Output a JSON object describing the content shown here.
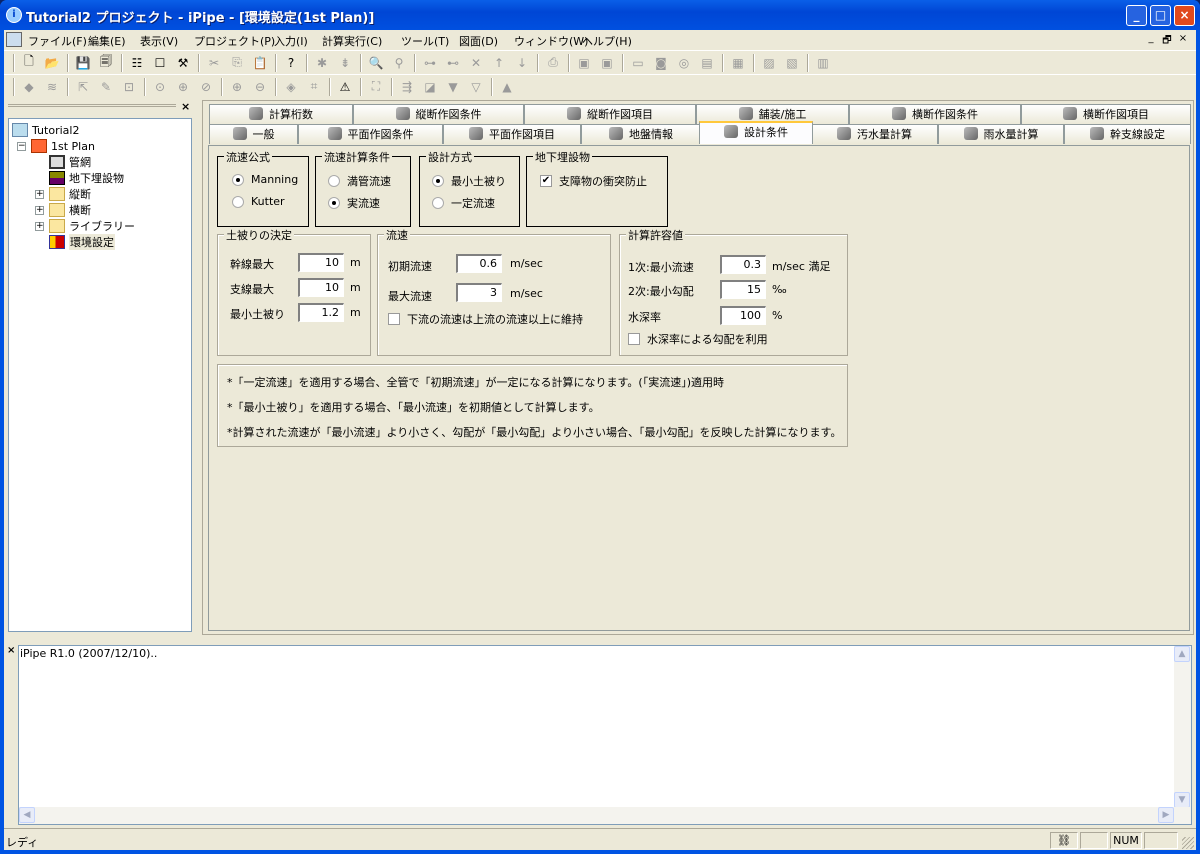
{
  "window": {
    "title": "Tutorial2 プロジェクト - iPipe - [環境設定(1st Plan)]",
    "minimize": "_",
    "maximize": "□",
    "close": "×"
  },
  "menu": [
    "ファイル(F)",
    "編集(E)",
    "表示(V)",
    "プロジェクト(P)",
    "入力(I)",
    "計算実行(C)",
    "ツール(T)",
    "図面(D)",
    "ウィンドウ(W)",
    "ヘルプ(H)"
  ],
  "mdi_controls": [
    "_",
    "🗗",
    "×"
  ],
  "toolbar1": [
    {
      "icon": "new-file-icon",
      "g": "🗋",
      "on": true
    },
    {
      "icon": "open-folder-icon",
      "g": "📂",
      "on": true
    },
    {
      "sep": true
    },
    {
      "icon": "save-icon",
      "g": "💾",
      "on": true
    },
    {
      "icon": "save-all-icon",
      "g": "🗐",
      "on": true
    },
    {
      "sep": true
    },
    {
      "icon": "tree-view-icon",
      "g": "☷",
      "on": true
    },
    {
      "icon": "window-icon",
      "g": "☐",
      "on": true
    },
    {
      "icon": "hammer-icon",
      "g": "⚒",
      "on": true
    },
    {
      "sep": true
    },
    {
      "icon": "cut-icon",
      "g": "✂"
    },
    {
      "icon": "copy-icon",
      "g": "⎘"
    },
    {
      "icon": "paste-icon",
      "g": "📋"
    },
    {
      "sep": true
    },
    {
      "icon": "help-icon",
      "g": "?",
      "on": true
    },
    {
      "sep": true
    },
    {
      "icon": "bug-icon",
      "g": "✱"
    },
    {
      "icon": "sort-icon",
      "g": "⇟"
    },
    {
      "sep": true
    },
    {
      "icon": "find-icon",
      "g": "🔍"
    },
    {
      "icon": "find-replace-icon",
      "g": "⚲"
    },
    {
      "sep": true
    },
    {
      "icon": "insert-node-icon",
      "g": "⊶"
    },
    {
      "icon": "insert-node2-icon",
      "g": "⊷"
    },
    {
      "icon": "delete-icon",
      "g": "✕"
    },
    {
      "icon": "arrow-up-icon",
      "g": "↑"
    },
    {
      "icon": "arrow-down-icon",
      "g": "↓"
    },
    {
      "sep": true
    },
    {
      "icon": "print-icon",
      "g": "⎙"
    },
    {
      "sep": true
    },
    {
      "icon": "drawing1-icon",
      "g": "▣"
    },
    {
      "icon": "drawing2-icon",
      "g": "▣"
    },
    {
      "sep": true
    },
    {
      "icon": "drawing3-icon",
      "g": "▭"
    },
    {
      "icon": "drawing4-icon",
      "g": "◙"
    },
    {
      "icon": "drawing5-icon",
      "g": "◎"
    },
    {
      "icon": "drawing6-icon",
      "g": "▤"
    },
    {
      "sep": true
    },
    {
      "icon": "drawing7-icon",
      "g": "▦"
    },
    {
      "sep": true
    },
    {
      "icon": "chart1-icon",
      "g": "▨"
    },
    {
      "icon": "chart2-icon",
      "g": "▧"
    },
    {
      "sep": true
    },
    {
      "icon": "table-icon",
      "g": "▥"
    }
  ],
  "toolbar2": [
    {
      "icon": "select-icon",
      "g": "◆"
    },
    {
      "icon": "layers-icon",
      "g": "≋"
    },
    {
      "sep": true
    },
    {
      "icon": "pointer-icon",
      "g": "⇱"
    },
    {
      "icon": "edit-point-icon",
      "g": "✎"
    },
    {
      "icon": "zoom-window-icon",
      "g": "⊡"
    },
    {
      "sep": true
    },
    {
      "icon": "zoom-all-icon",
      "g": "⊙"
    },
    {
      "icon": "zoom-pan-icon",
      "g": "⊕"
    },
    {
      "icon": "zoom-previous-icon",
      "g": "⊘"
    },
    {
      "sep": true
    },
    {
      "icon": "zoom-in-icon",
      "g": "⊕"
    },
    {
      "icon": "zoom-out-icon",
      "g": "⊖"
    },
    {
      "sep": true
    },
    {
      "icon": "fill-icon",
      "g": "◈"
    },
    {
      "icon": "dimension-icon",
      "g": "⌗"
    },
    {
      "sep": true
    },
    {
      "icon": "warning-icon",
      "g": "⚠",
      "on": true
    },
    {
      "sep": true
    },
    {
      "icon": "manhole-icon",
      "g": "⛶"
    },
    {
      "sep": true
    },
    {
      "icon": "pipe-icon",
      "g": "⇶"
    },
    {
      "icon": "profile-icon",
      "g": "◪"
    },
    {
      "icon": "cup-icon",
      "g": "▼"
    },
    {
      "icon": "box-icon",
      "g": "▽"
    },
    {
      "sep": true
    },
    {
      "icon": "triangle-icon",
      "g": "▲"
    }
  ],
  "tree": {
    "root": "Tutorial2",
    "plan": "1st Plan",
    "items": [
      "管網",
      "地下埋設物",
      "縦断",
      "横断",
      "ライブラリー",
      "環境設定"
    ]
  },
  "tabs_row1": [
    "計算桁数",
    "縦断作図条件",
    "縦断作図項目",
    "舗装/施工",
    "横断作図条件",
    "横断作図項目"
  ],
  "tabs_row2": [
    "一般",
    "平面作図条件",
    "平面作図項目",
    "地盤情報",
    "設計条件",
    "汚水量計算",
    "雨水量計算",
    "幹支線設定"
  ],
  "form": {
    "velocity_formula": {
      "label": "流速公式",
      "options": [
        "Manning",
        "Kutter"
      ],
      "selected": 0
    },
    "velocity_condition": {
      "label": "流速計算条件",
      "options": [
        "満管流速",
        "実流速"
      ],
      "selected": 1
    },
    "design_method": {
      "label": "設計方式",
      "options": [
        "最小土被り",
        "一定流速"
      ],
      "selected": 0
    },
    "underground": {
      "label": "地下埋設物",
      "checkbox": "支障物の衝突防止",
      "checked": true
    },
    "cover": {
      "label": "土被りの決定",
      "rows": [
        {
          "label": "幹線最大",
          "value": "10",
          "unit": "m"
        },
        {
          "label": "支線最大",
          "value": "10",
          "unit": "m"
        },
        {
          "label": "最小土被り",
          "value": "1.2",
          "unit": "m"
        }
      ]
    },
    "velocity": {
      "label": "流速",
      "rows": [
        {
          "label": "初期流速",
          "value": "0.6",
          "unit": "m/sec"
        },
        {
          "label": "最大流速",
          "value": "3",
          "unit": "m/sec"
        }
      ],
      "checkbox": "下流の流速は上流の流速以上に維持",
      "checked": false
    },
    "tolerance": {
      "label": "計算許容値",
      "rows": [
        {
          "label": "1次:最小流速",
          "value": "0.3",
          "unit": "m/sec 満足"
        },
        {
          "label": "2次:最小勾配",
          "value": "15",
          "unit": "‰"
        },
        {
          "label": "水深率",
          "value": "100",
          "unit": "%"
        }
      ],
      "checkbox": "水深率による勾配を利用",
      "checked": false
    },
    "notes": [
      "*「一定流速」を適用する場合、全管で「初期流速」が一定になる計算になります。(「実流速」)適用時",
      "*「最小土被り」を適用する場合、「最小流速」を初期値として計算します。",
      "*計算された流速が「最小流速」より小さく、勾配が「最小勾配」より小さい場合、「最小勾配」を反映した計算になります。"
    ]
  },
  "output": {
    "text": "iPipe R1.0 (2007/12/10)..",
    "close": "×"
  },
  "status": {
    "text": "レディ",
    "num": "NUM"
  },
  "colors": {
    "title": "#0054e3",
    "face": "#ece9d8",
    "selected_tab": "#ffc83c"
  }
}
